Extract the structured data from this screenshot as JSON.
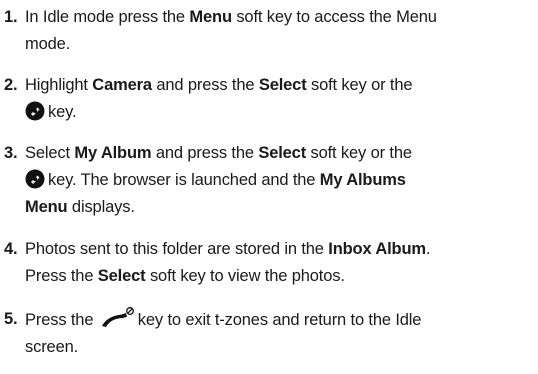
{
  "steps": [
    {
      "number": "1.",
      "parts": [
        "In Idle mode press the ",
        "Menu",
        " soft key to access the Menu",
        "mode."
      ]
    },
    {
      "number": "2.",
      "parts": [
        "Highlight ",
        "Camera",
        " and press the ",
        "Select",
        " soft key or the",
        "key."
      ]
    },
    {
      "number": "3.",
      "parts": [
        "Select ",
        "My Album",
        " and press the ",
        "Select",
        " soft key or the",
        "key. The browser is launched and the ",
        "My Albums",
        "Menu",
        " displays."
      ]
    },
    {
      "number": "4.",
      "parts": [
        "Photos sent to this folder are stored in the ",
        "Inbox Album",
        ".",
        "Press the ",
        "Select",
        " soft key to view the photos."
      ]
    },
    {
      "number": "5.",
      "parts": [
        "Press the ",
        "key to exit t-zones and return to the Idle",
        "screen."
      ]
    }
  ],
  "icons": {
    "select_key": "i-select-key-icon",
    "end_key": "end-call-key-icon"
  }
}
